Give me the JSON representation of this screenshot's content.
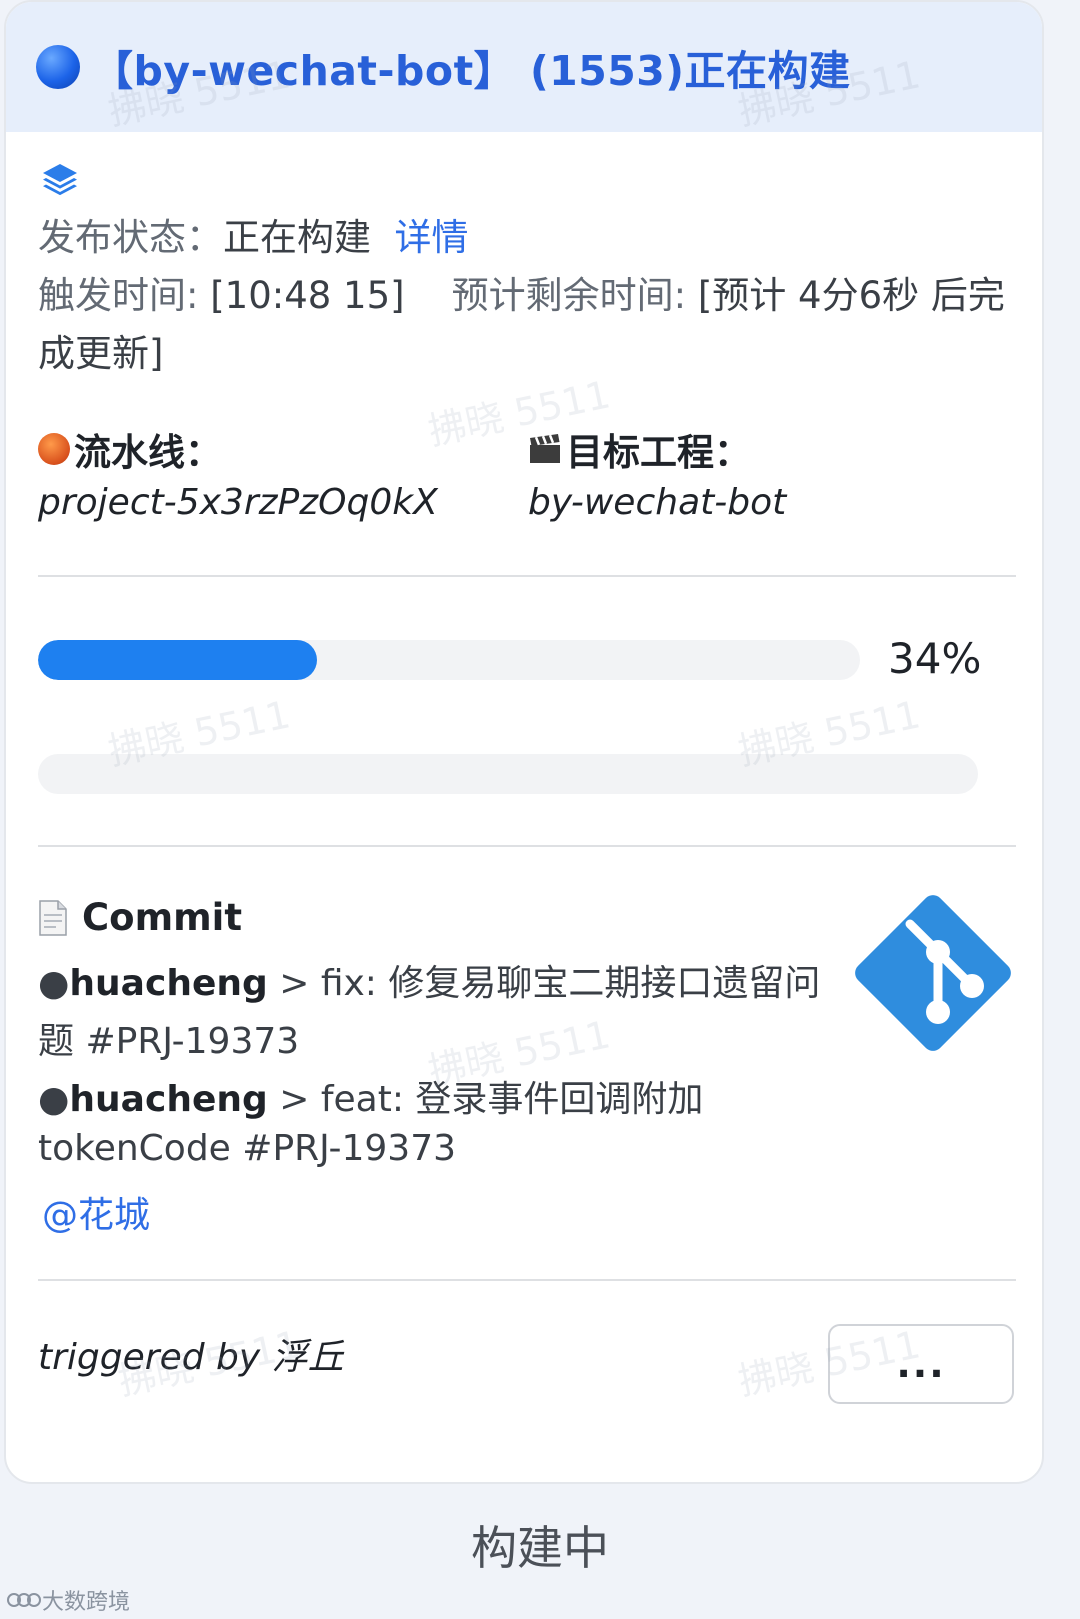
{
  "header": {
    "title": "【by-wechat-bot】 (1553)正在构建",
    "status_color": "#1c63e8"
  },
  "status": {
    "label": "发布状态：",
    "value": "正在构建",
    "detail_link": "详情"
  },
  "trigger_time": {
    "label": "触发时间: ",
    "value": "[10:48 15]",
    "remaining_label": "预计剩余时间: ",
    "remaining_value_line1": "[预计 4分6秒 后完",
    "remaining_value_line2": "成更新]"
  },
  "pipeline": {
    "label": "流水线：",
    "value": "project-5x3rzPzOq0kX"
  },
  "target": {
    "label": "目标工程：",
    "value": "by-wechat-bot"
  },
  "progress": {
    "percent": 34,
    "label": "34%",
    "second_bar_percent": 0,
    "fill_color": "#1e80f0"
  },
  "commit": {
    "title": "Commit",
    "entries": [
      {
        "bullet": "●",
        "author": "huacheng",
        "sep": " > ",
        "message_line1": "fix: 修复易聊宝二期接口遗留问",
        "message_line2": "题 #PRJ-19373"
      },
      {
        "bullet": "●",
        "author": "huacheng",
        "sep": " > ",
        "message_line1": "feat: 登录事件回调附加",
        "message_line2": "tokenCode #PRJ-19373"
      }
    ],
    "mention": "@花城",
    "logo_color": "#2f8dde"
  },
  "footer": {
    "triggered_by": "triggered by 浮丘",
    "more_label": "...",
    "status_text": "构建中"
  },
  "watermark_text": "拂晓 5511",
  "corner_brand": "大数跨境",
  "icons": {
    "status": "blue-circle-icon",
    "layers": "layers-icon",
    "pipeline": "yarn-ball-icon",
    "target": "clapper-board-icon",
    "commit": "document-icon",
    "git": "git-logo-icon"
  }
}
